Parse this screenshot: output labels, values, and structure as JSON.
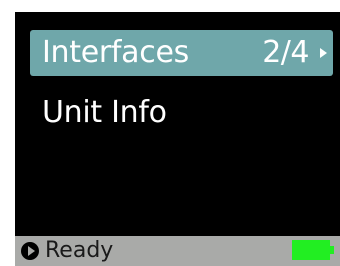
{
  "menu": {
    "items": [
      {
        "label": "Interfaces",
        "index": "2/4",
        "selected": true
      },
      {
        "label": "Unit Info",
        "selected": false
      }
    ]
  },
  "status": {
    "text": "Ready",
    "battery_level": 1.0,
    "icons": {
      "play": "play-circle-icon",
      "battery": "battery-icon",
      "submenu_arrow": "chevron-right-icon"
    }
  },
  "colors": {
    "background": "#000000",
    "selection": "#6fa7aa",
    "status_bar": "#a9aaa8",
    "battery": "#22ee22"
  }
}
